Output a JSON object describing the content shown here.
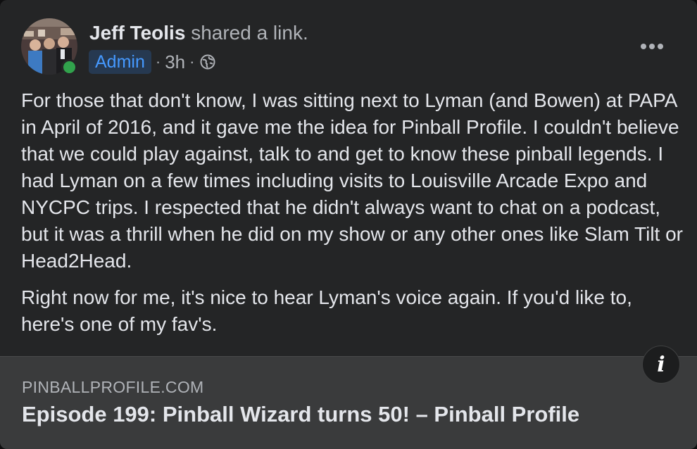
{
  "post": {
    "author": "Jeff Teolis",
    "action": "shared a link.",
    "badge": "Admin",
    "separator": "·",
    "time": "3h",
    "paragraphs": [
      "For those that don't know, I was sitting next to Lyman (and Bowen) at PAPA in April of 2016, and it gave me the idea for Pinball Profile.  I couldn't believe that we could play against, talk to and get to know these pinball legends.  I had Lyman on a few times including visits to Louisville Arcade Expo and NYCPC trips.  I respected that he didn't always want to chat on a podcast, but it was a thrill when he did on my show or any other ones like Slam Tilt or Head2Head.",
      "Right now for me, it's nice to hear Lyman's voice again.  If you'd like to, here's one of my fav's."
    ]
  },
  "link_preview": {
    "domain": "PINBALLPROFILE.COM",
    "title": "Episode 199: Pinball Wizard turns 50! – Pinball Profile",
    "info_glyph": "i"
  },
  "icons": {
    "more": "more-horizontal-icon",
    "privacy": "globe-icon",
    "info": "info-icon"
  },
  "colors": {
    "card_bg": "#242526",
    "badge_bg": "#263951",
    "badge_text": "#4599ff",
    "online": "#31a24c",
    "link_bg": "#3a3b3c"
  }
}
